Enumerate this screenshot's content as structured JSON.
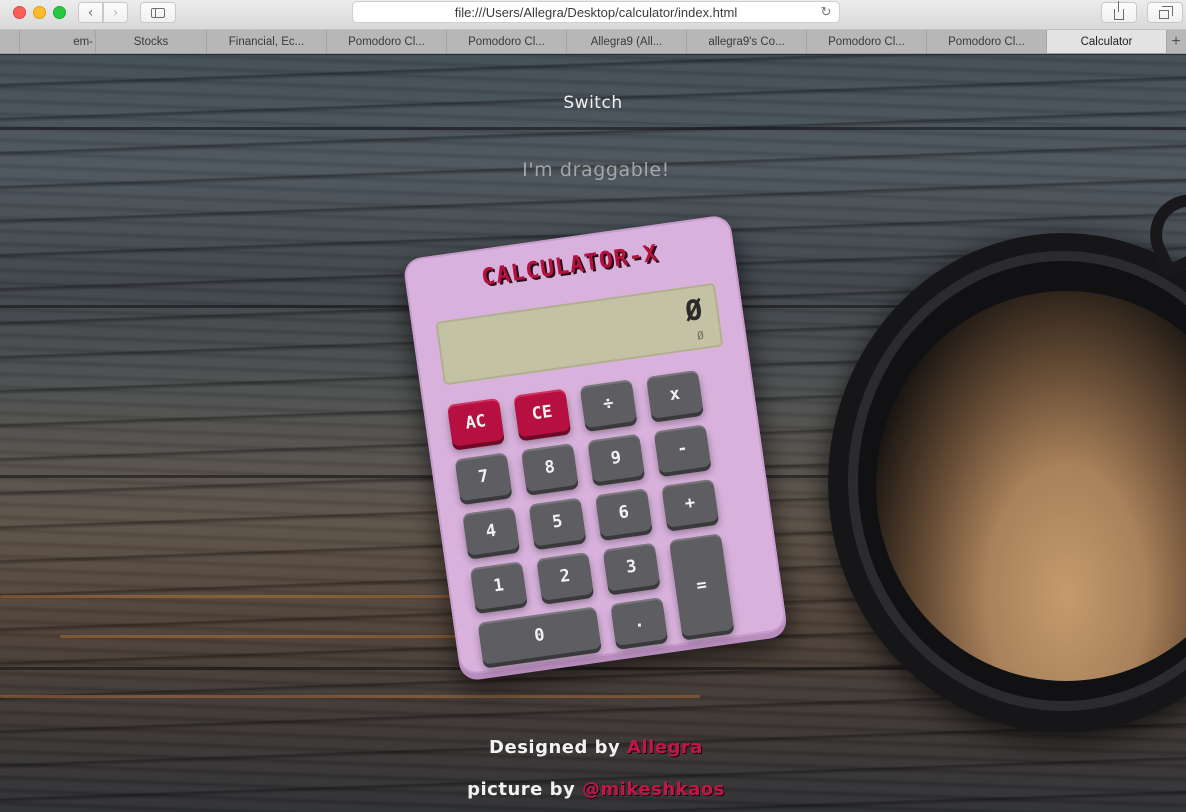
{
  "browser": {
    "url": "file:///Users/Allegra/Desktop/calculator/index.html",
    "tabs": [
      {
        "label": ""
      },
      {
        "label": "em-"
      },
      {
        "label": "Stocks"
      },
      {
        "label": "Financial, Ec..."
      },
      {
        "label": "Pomodoro Cl..."
      },
      {
        "label": "Pomodoro Cl..."
      },
      {
        "label": "Allegra9 (All..."
      },
      {
        "label": "allegra9's Co..."
      },
      {
        "label": "Pomodoro Cl..."
      },
      {
        "label": "Pomodoro Cl..."
      },
      {
        "label": "Calculator"
      }
    ],
    "active_tab": "Calculator",
    "new_tab_symbol": "+",
    "icons": {
      "back": "chevron-left-icon",
      "forward": "chevron-right-icon",
      "sidebar": "sidebar-icon",
      "reload": "reload-icon",
      "share": "share-icon",
      "tabs": "tab-overview-icon"
    }
  },
  "page": {
    "switch_label": "Switch",
    "drag_hint": "I'm draggable!",
    "credit_designed_prefix": "Designed by",
    "credit_designed_name": "Allegra",
    "credit_picture_prefix": "picture by",
    "credit_picture_name": "@mikeshkaos"
  },
  "calculator": {
    "brand": "CALCULATOR-X",
    "display_value": "Ø",
    "display_history": "Ø",
    "keys": {
      "ac": "AC",
      "ce": "CE",
      "divide": "÷",
      "multiply": "x",
      "seven": "7",
      "eight": "8",
      "nine": "9",
      "minus": "-",
      "four": "4",
      "five": "5",
      "six": "6",
      "plus": "+",
      "one": "1",
      "two": "2",
      "three": "3",
      "equals": "=",
      "zero": "0",
      "decimal": "."
    }
  },
  "colors": {
    "accent": "#b5103f",
    "calculator_body": "#d8b2dc",
    "display": "#c4c2a4",
    "key": "#5e5e62"
  }
}
